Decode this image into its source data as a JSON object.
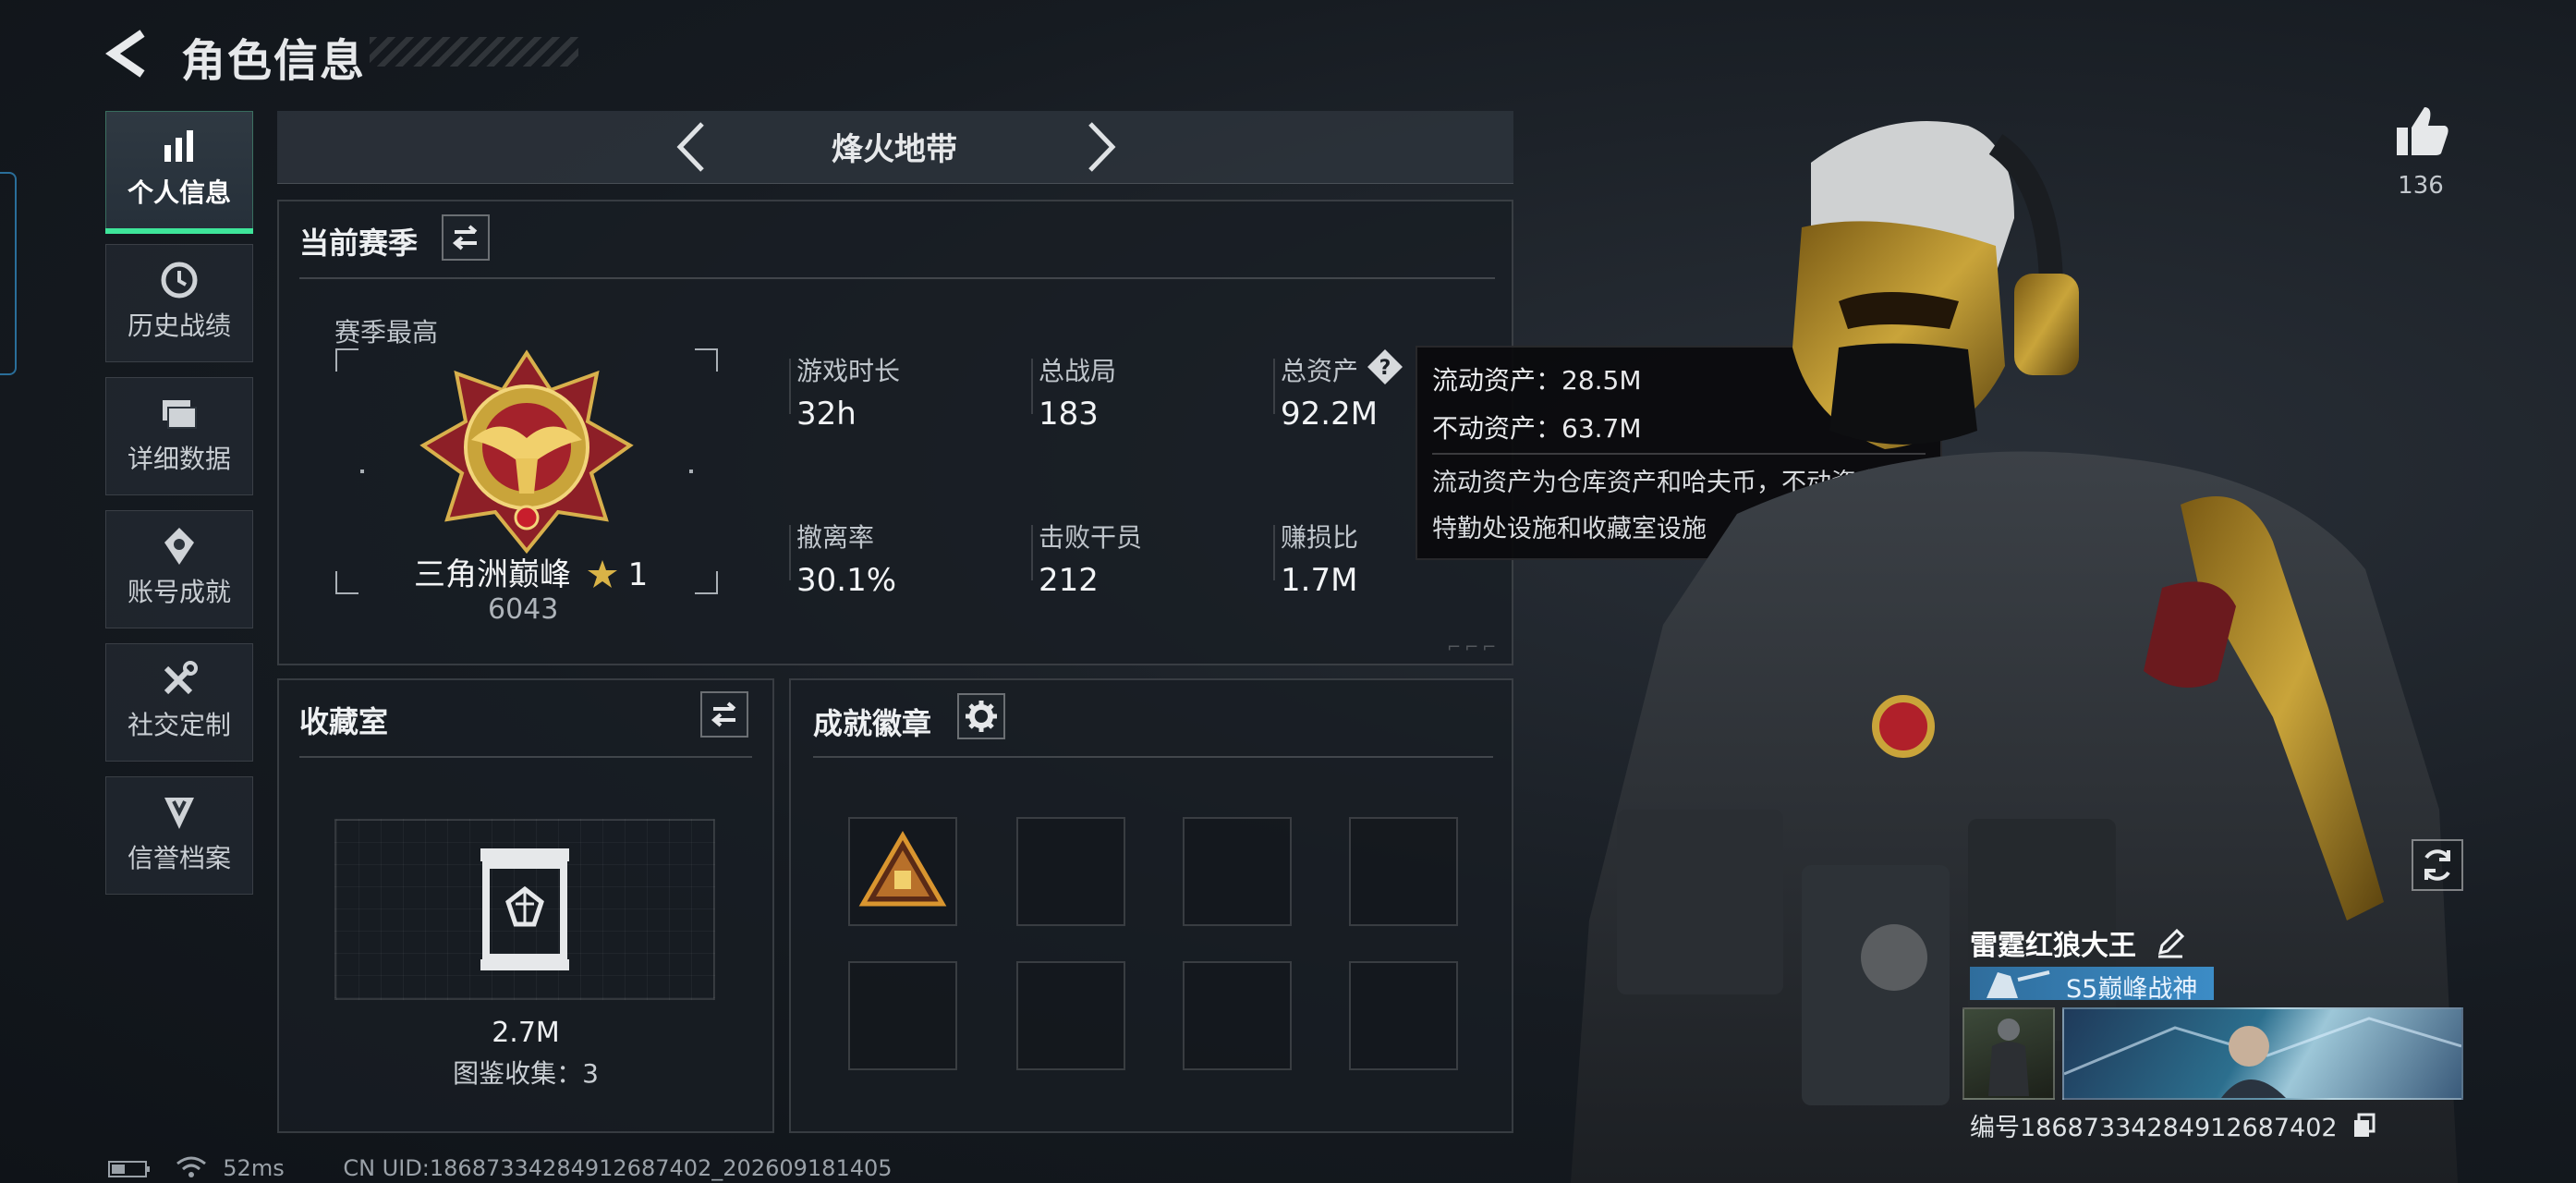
{
  "header": {
    "title": "角色信息"
  },
  "nav": [
    {
      "label": "个人信息",
      "icon": "bar-chart-icon",
      "active": true
    },
    {
      "label": "历史战绩",
      "icon": "clock-icon"
    },
    {
      "label": "详细数据",
      "icon": "folders-icon"
    },
    {
      "label": "账号成就",
      "icon": "medal-icon"
    },
    {
      "label": "社交定制",
      "icon": "tools-icon"
    },
    {
      "label": "信誉档案",
      "icon": "shield-rank-icon"
    }
  ],
  "mode": {
    "title": "烽火地带"
  },
  "season": {
    "title": "当前赛季",
    "best_label": "赛季最高",
    "rank_name": "三角洲巅峰",
    "rank_stars": "1",
    "rank_score": "6043",
    "stats": [
      {
        "label": "游戏时长",
        "value": "32h"
      },
      {
        "label": "总战局",
        "value": "183"
      },
      {
        "label": "总资产",
        "value": "92.2M"
      },
      {
        "label": "撤离率",
        "value": "30.1%"
      },
      {
        "label": "击败干员",
        "value": "212"
      },
      {
        "label": "赚损比",
        "value": "1.7M"
      }
    ]
  },
  "tooltip": {
    "liquid": "流动资产：28.5M",
    "fixed": "不动资产：63.7M",
    "description": "流动资产为仓库资产和哈夫币，不动资产为特勤处设施和收藏室设施"
  },
  "collection": {
    "title": "收藏室",
    "value": "2.7M",
    "count": "图鉴收集：3"
  },
  "achievements": {
    "title": "成就徽章"
  },
  "player": {
    "likes": "136",
    "name": "雷霆红狼大王",
    "badge_title": "S5巅峰战神",
    "uid": "编号18687334284912687402"
  },
  "footer": {
    "ping": "52ms",
    "uid": "CN UID:18687334284912687402_202609181405"
  },
  "colors": {
    "accent_green": "#3ee59a",
    "badge_blue": "#3c8cc6",
    "gold": "#c9a43a",
    "rank_red": "#a4222b"
  }
}
